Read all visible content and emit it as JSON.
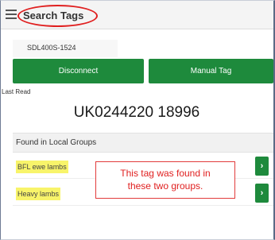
{
  "header": {
    "title": "Search Tags",
    "menu_icon": "hamburger-menu-icon"
  },
  "device": {
    "id": "SDL400S-1524"
  },
  "actions": {
    "disconnect_label": "Disconnect",
    "manual_tag_label": "Manual Tag"
  },
  "last_read": {
    "label": "Last Read",
    "value": "UK0244220 18996"
  },
  "groups": {
    "header": "Found in Local Groups",
    "items": [
      {
        "label": "BFL ewe lambs",
        "chevron": "›"
      },
      {
        "label": "Heavy lambs",
        "chevron": "›"
      }
    ]
  },
  "annotation": {
    "line1": "This tag was found in",
    "line2": "these two groups."
  },
  "colors": {
    "accent_green": "#1e8a3c",
    "highlight_yellow": "#f8f46a",
    "annotation_red": "#e02020"
  }
}
